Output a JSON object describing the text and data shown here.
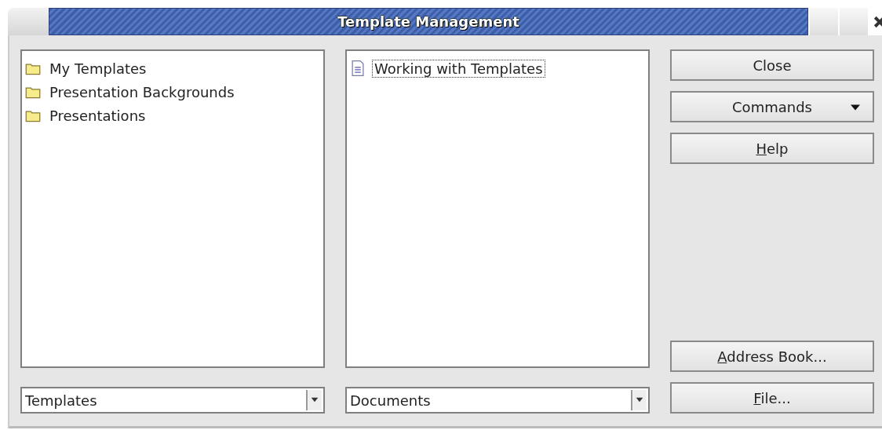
{
  "window": {
    "title": "Template Management"
  },
  "categories": {
    "items": [
      {
        "label": "My Templates",
        "focused": false
      },
      {
        "label": "Presentation Backgrounds",
        "focused": false
      },
      {
        "label": "Presentations",
        "focused": false
      }
    ]
  },
  "documents": {
    "items": [
      {
        "label": "Working with Templates",
        "focused": true
      }
    ]
  },
  "category_dropdown": {
    "value": "Templates"
  },
  "document_dropdown": {
    "value": "Documents"
  },
  "buttons": [
    {
      "kind": "plain",
      "label": "Close",
      "underline_first": false
    },
    {
      "kind": "menu",
      "label": "Commands",
      "underline_first": false
    },
    {
      "kind": "plain",
      "label": "Help",
      "underline_first": true
    },
    {
      "kind": "spacer"
    },
    {
      "kind": "plain",
      "label": "Address Book...",
      "underline_first": true
    },
    {
      "kind": "plain",
      "label": "File...",
      "underline_first": true
    }
  ]
}
